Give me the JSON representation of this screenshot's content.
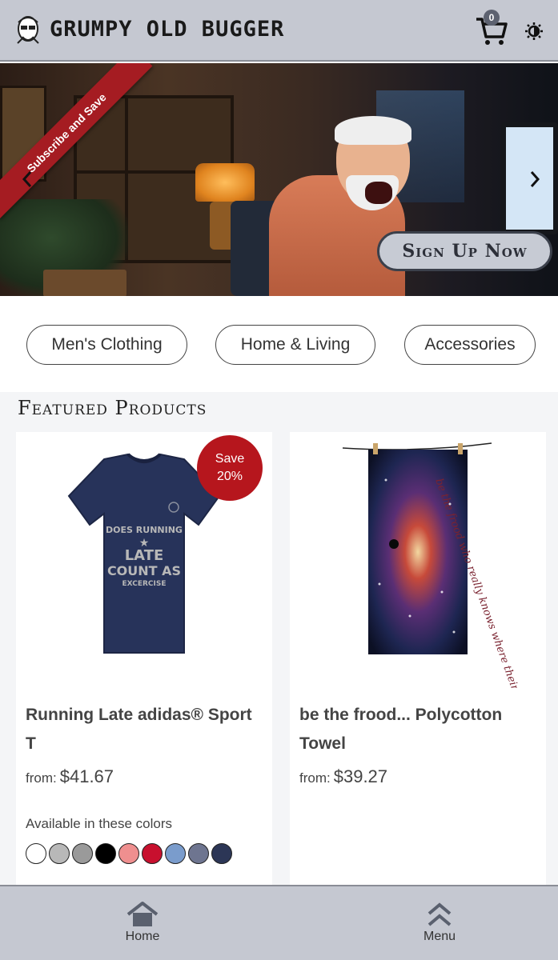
{
  "header": {
    "brand": "GRUMPY OLD BUGGER",
    "cart_count": "0",
    "icons": [
      "grumpy-face-logo",
      "cart-icon",
      "theme-toggle-icon"
    ]
  },
  "hero": {
    "ribbon": "Subscribe and Save",
    "cta": "Sign Up Now",
    "icons": [
      "chevron-left-icon",
      "chevron-right-icon"
    ]
  },
  "categories": [
    "Men's Clothing",
    "Home & Living",
    "Accessories"
  ],
  "featured": {
    "title": "Featured Products",
    "products": [
      {
        "name": "Running Late adidas® Sport T",
        "price_prefix": "from:",
        "price": "$41.67",
        "badge_line1": "Save",
        "badge_line2": "20%",
        "image_text_1": "DOES RUNNING",
        "image_text_2": "LATE",
        "image_text_3": "COUNT AS",
        "image_text_4": "EXCERCISE",
        "colors_label": "Available in these colors",
        "colors": [
          "#ffffff",
          "#b8b8b8",
          "#9a9a9a",
          "#000000",
          "#ef8f8f",
          "#c8102e",
          "#7a9ccc",
          "#6e7590",
          "#2c3656"
        ]
      },
      {
        "name": "be the frood... Polycotton Towel",
        "price_prefix": "from:",
        "price": "$39.27",
        "image_text": "be the frood who really knows where their towel is"
      }
    ]
  },
  "bottom_nav": {
    "home": "Home",
    "menu": "Menu"
  }
}
